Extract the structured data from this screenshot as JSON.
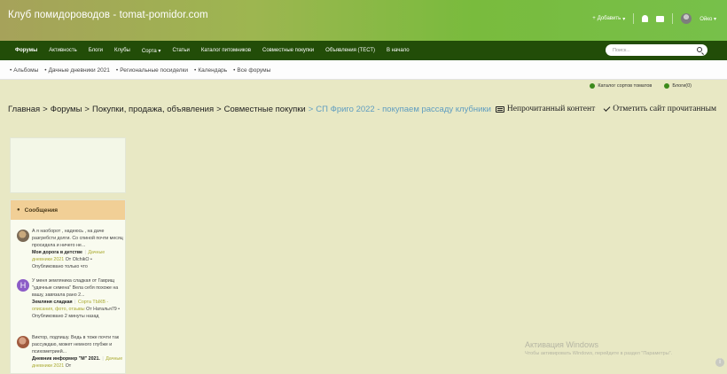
{
  "header": {
    "site_title": "Клуб помидороводов - tomat-pomidor.com",
    "add_label": "Добавить",
    "user_name": "Ойко"
  },
  "nav": {
    "items": [
      "Форумы",
      "Активность",
      "Блоги",
      "Клубы",
      "Сорта",
      "Статьи",
      "Каталог питомников",
      "Совместные покупки",
      "Объявления (ТЕСТ)",
      "В начало"
    ],
    "search_placeholder": "Поиск..."
  },
  "subnav": {
    "items": [
      "Альбомы",
      "Дачные дневники 2021",
      "Региональные посиделки",
      "Календарь",
      "Все форумы"
    ]
  },
  "quick_links": [
    "Каталог сортов томатов",
    "Блоги(0)"
  ],
  "breadcrumb": {
    "items": [
      "Главная",
      "Форумы",
      "Покупки, продажа, объявления",
      "Совместные покупки"
    ],
    "current": "СП Фриго 2022 - покупаем рассаду клубники",
    "unread_label": "Непрочитанный контент",
    "mark_read_label": "Отметить сайт прочитанным"
  },
  "sidebar": {
    "panel_title": "Сообщения",
    "messages": [
      {
        "avatar_letter": "",
        "text": "А я наоборот , надеюсь , на даче разгребсти долги. Со спиной почти месяц просидела и ничего не...",
        "title": "Моя дорога в детстве",
        "category": "Дачные дневники 2021",
        "meta": "От OlchikO • Опубликовано только что"
      },
      {
        "avatar_letter": "H",
        "text": "У меня земляника сладкая от Гаврищ \"удачные семена\" Вела себя похоже на вашу, завязала рано 2...",
        "title": "Земляня сладкая",
        "category": "Сорта ТЫКВ - описания, фото, отзывы",
        "meta": "От Наталья79 • Опубликовано 2 минуты назад"
      },
      {
        "avatar_letter": "",
        "text": "Виктор, подпишу. Ведь в тоже почти так рассуждаю, может немного глубже и психометрией...",
        "title": "Дневник информер \"М\" 2021.",
        "category": "Дачные дневники 2021",
        "meta": "От"
      }
    ]
  },
  "watermark": {
    "title": "Активация Windows",
    "subtitle": "Чтобы активировать Windows, перейдите в раздел \"Параметры\"."
  },
  "colors": {
    "nav_bg": "#224d08",
    "header_start": "#a6a25a",
    "header_end": "#77c04a",
    "panel_head": "#f1cf96",
    "breadcrumb_current": "#5f9dc0"
  }
}
